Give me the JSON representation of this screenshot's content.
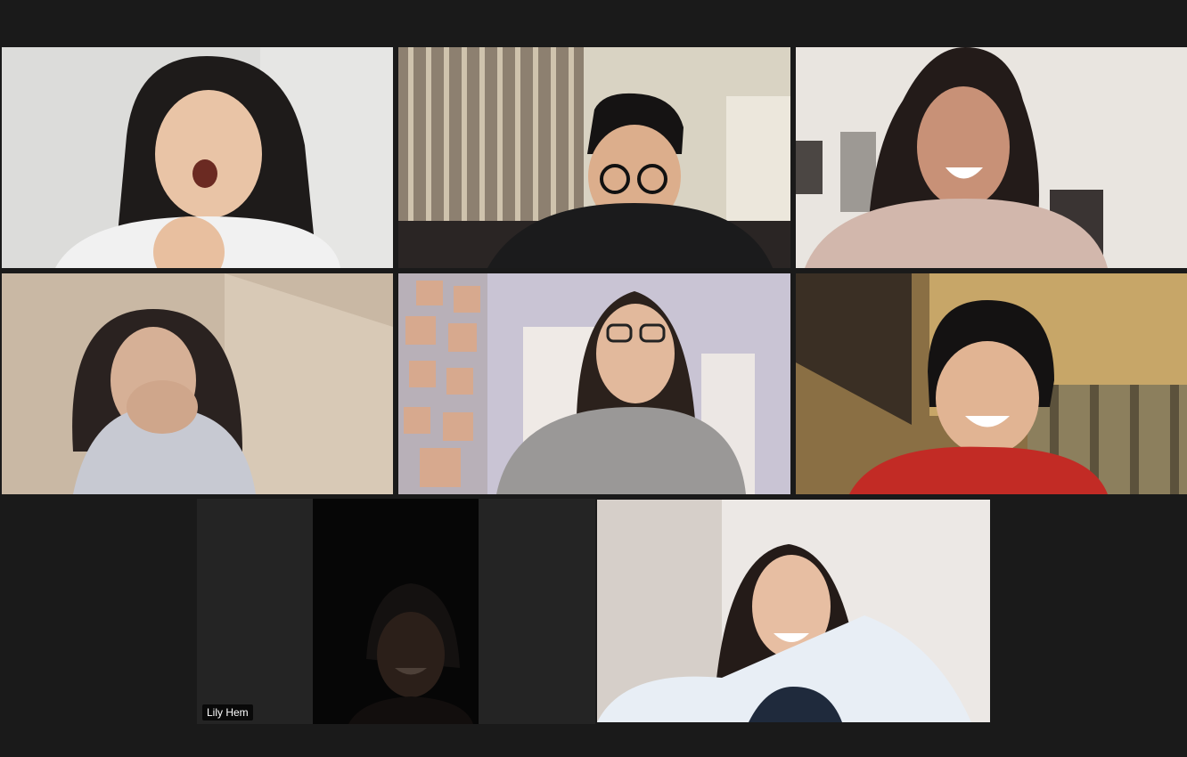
{
  "meeting": {
    "layout": "gallery-view",
    "active_speaker_color": "#c8e55a",
    "background_color": "#1a1a1a"
  },
  "participants": [
    {
      "tile": "t1",
      "name": "",
      "camera": "on",
      "thumb_icon": "person-eating-icon"
    },
    {
      "tile": "t2",
      "name": "",
      "camera": "on",
      "thumb_icon": "person-glasses-icon"
    },
    {
      "tile": "t3",
      "name": "",
      "camera": "on",
      "thumb_icon": "person-smiling-icon"
    },
    {
      "tile": "t4",
      "name": "",
      "camera": "on",
      "thumb_icon": "person-laughing-icon"
    },
    {
      "tile": "t5",
      "name": "",
      "camera": "on",
      "thumb_icon": "person-glasses-icon"
    },
    {
      "tile": "t6",
      "name": "",
      "camera": "on",
      "thumb_icon": "person-laughing-icon"
    },
    {
      "tile": "t7",
      "name": "Lily Hem",
      "camera": "on",
      "active_speaker": true,
      "thumb_icon": "person-dark-icon"
    },
    {
      "tile": "t8",
      "name": "",
      "camera": "on",
      "thumb_icon": "person-smiling-icon"
    }
  ]
}
